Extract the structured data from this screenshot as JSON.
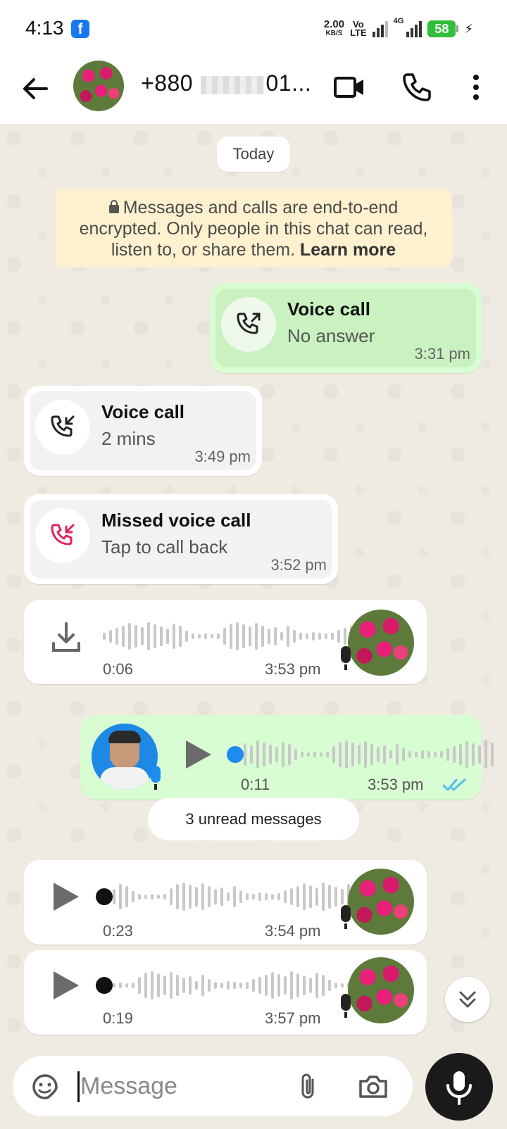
{
  "status_bar": {
    "time": "4:13",
    "net_speed_value": "2.00",
    "net_speed_unit": "KB/S",
    "volte_top": "Vo",
    "volte_bottom": "LTE",
    "network_type": "4G",
    "battery": "58"
  },
  "header": {
    "contact_prefix": "+880",
    "contact_suffix": "01..."
  },
  "chat": {
    "date_chip": "Today",
    "encryption_notice": "Messages and calls are end-to-end encrypted. Only people in this chat can read, listen to, or share them.",
    "learn_more": "Learn more",
    "messages": [
      {
        "type": "call",
        "direction": "outgoing",
        "title": "Voice call",
        "subtitle": "No answer",
        "time": "3:31 pm"
      },
      {
        "type": "call",
        "direction": "incoming",
        "title": "Voice call",
        "subtitle": "2 mins",
        "time": "3:49 pm"
      },
      {
        "type": "call",
        "direction": "missed",
        "title": "Missed voice call",
        "subtitle": "Tap to call back",
        "time": "3:52 pm"
      },
      {
        "type": "voice",
        "direction": "incoming",
        "duration": "0:06",
        "time": "3:53 pm",
        "state": "download"
      },
      {
        "type": "voice",
        "direction": "outgoing",
        "duration": "0:11",
        "time": "3:53 pm",
        "read": true
      },
      {
        "type": "voice",
        "direction": "incoming",
        "duration": "0:23",
        "time": "3:54 pm"
      },
      {
        "type": "voice",
        "direction": "incoming",
        "duration": "0:19",
        "time": "3:57 pm"
      }
    ],
    "unread_label": "3 unread messages"
  },
  "input": {
    "placeholder": "Message"
  },
  "colors": {
    "outgoing_bubble": "#d9fdd3",
    "incoming_bubble": "#ffffff",
    "missed_call": "#e0245e",
    "read_ticks": "#53bdeb",
    "voice_dot": "#1d8cf0",
    "chat_background": "#efeae2",
    "notice_background": "#fdf1cf"
  },
  "icons": [
    "facebook-icon",
    "back-arrow-icon",
    "video-call-icon",
    "phone-icon",
    "more-vert-icon",
    "lock-icon",
    "outgoing-call-icon",
    "incoming-call-icon",
    "missed-call-icon",
    "download-icon",
    "play-icon",
    "mic-icon",
    "double-check-icon",
    "chevron-double-down-icon",
    "sticker-icon",
    "attach-icon",
    "camera-icon"
  ]
}
